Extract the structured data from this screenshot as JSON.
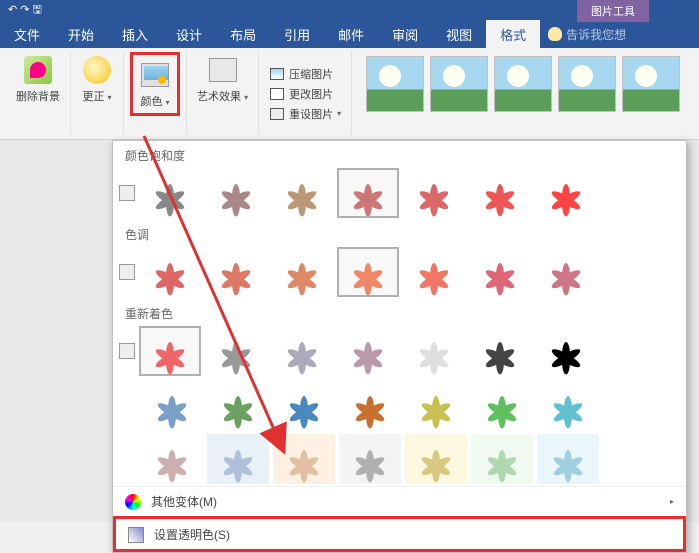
{
  "titlebar": {
    "context_tab": "图片工具"
  },
  "menu": {
    "tabs": [
      "文件",
      "开始",
      "插入",
      "设计",
      "布局",
      "引用",
      "邮件",
      "审阅",
      "视图",
      "格式"
    ],
    "active_index": 9,
    "tell_me": "告诉我您想"
  },
  "ribbon": {
    "remove_bg": "删除背景",
    "corrections": "更正",
    "color": "颜色",
    "artistic": "艺术效果",
    "compress": "压缩图片",
    "change": "更改图片",
    "reset": "重设图片"
  },
  "color_dropdown": {
    "sec_saturation": "颜色饱和度",
    "sec_tone": "色调",
    "sec_recolor": "重新着色",
    "more_variants": "其他变体(M)",
    "set_transparent": "设置透明色(S)",
    "saturation_tints": [
      "#888",
      "#a88",
      "#b97",
      "#c77",
      "#d66",
      "#e55",
      "#f44"
    ],
    "tone_tints": [
      "#d66",
      "#d76",
      "#d86",
      "#e86",
      "#e76",
      "#d67",
      "#c78"
    ],
    "recolor": [
      [
        "#e66",
        "#999",
        "#aab",
        "#b9a",
        "#dedede",
        "#444",
        "#000"
      ],
      [
        "#7aa0c8",
        "#6aa060",
        "#4a88c0",
        "#c87030",
        "#c8c050",
        "#60c060",
        "#60c0d0"
      ]
    ],
    "recolor_wash": [
      "#ccb0b0",
      "#b0c0d8",
      "#e0c0a0",
      "#b0b0b0",
      "#d8c880",
      "#b0d8b0",
      "#a0d0e0"
    ],
    "bg_wash": [
      "#ffffff",
      "#e8f0f8",
      "#fff0e4",
      "#f4f4f4",
      "#fcf8e0",
      "#f0faf0",
      "#eaf6fa"
    ]
  }
}
